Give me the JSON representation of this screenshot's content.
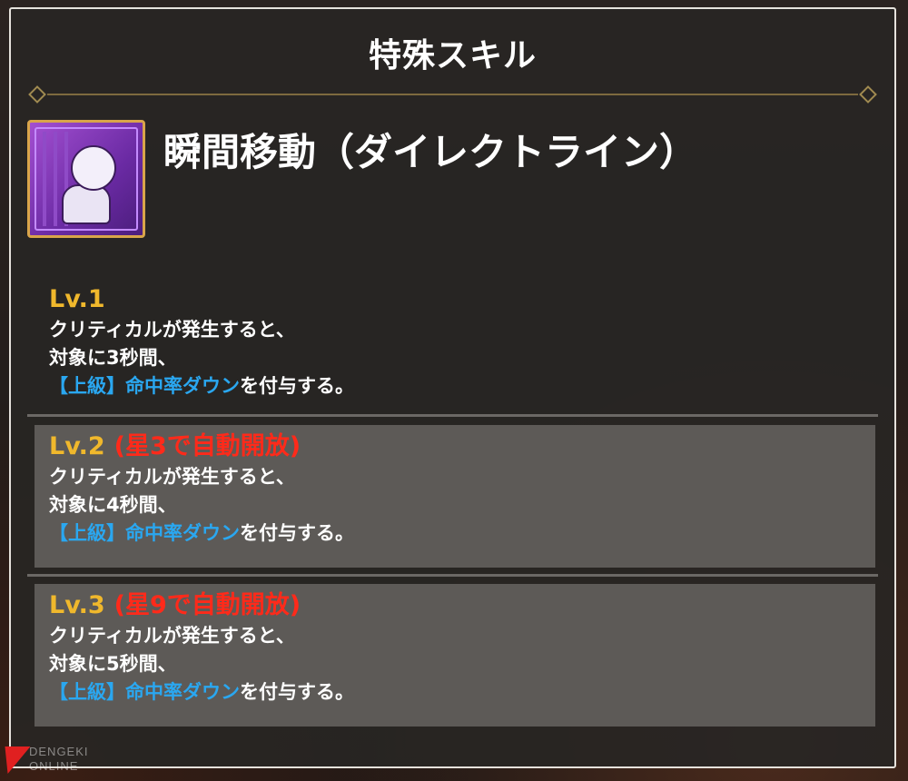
{
  "panel": {
    "title": "特殊スキル"
  },
  "skill": {
    "icon": "ghost-icon",
    "name": "瞬間移動（ダイレクトライン）"
  },
  "levels": [
    {
      "label": "Lv.1",
      "unlock": "",
      "line1": "クリティカルが発生すると、",
      "line2": "対象に3秒間、",
      "effect_tag": "【上級】命中率ダウン",
      "effect_suffix": "を付与する。"
    },
    {
      "label": "Lv.2",
      "unlock": "(星3で自動開放)",
      "line1": "クリティカルが発生すると、",
      "line2": "対象に4秒間、",
      "effect_tag": "【上級】命中率ダウン",
      "effect_suffix": "を付与する。"
    },
    {
      "label": "Lv.3",
      "unlock": "(星9で自動開放)",
      "line1": "クリティカルが発生すると、",
      "line2": "対象に5秒間、",
      "effect_tag": "【上級】命中率ダウン",
      "effect_suffix": "を付与する。"
    }
  ],
  "watermark": {
    "line1": "DENGEKI",
    "line2": "ONLINE"
  },
  "colors": {
    "level_label": "#f0b82c",
    "unlock": "#ff2a1a",
    "effect_tag": "#2aa7f0",
    "frame": "#d9a54a"
  }
}
